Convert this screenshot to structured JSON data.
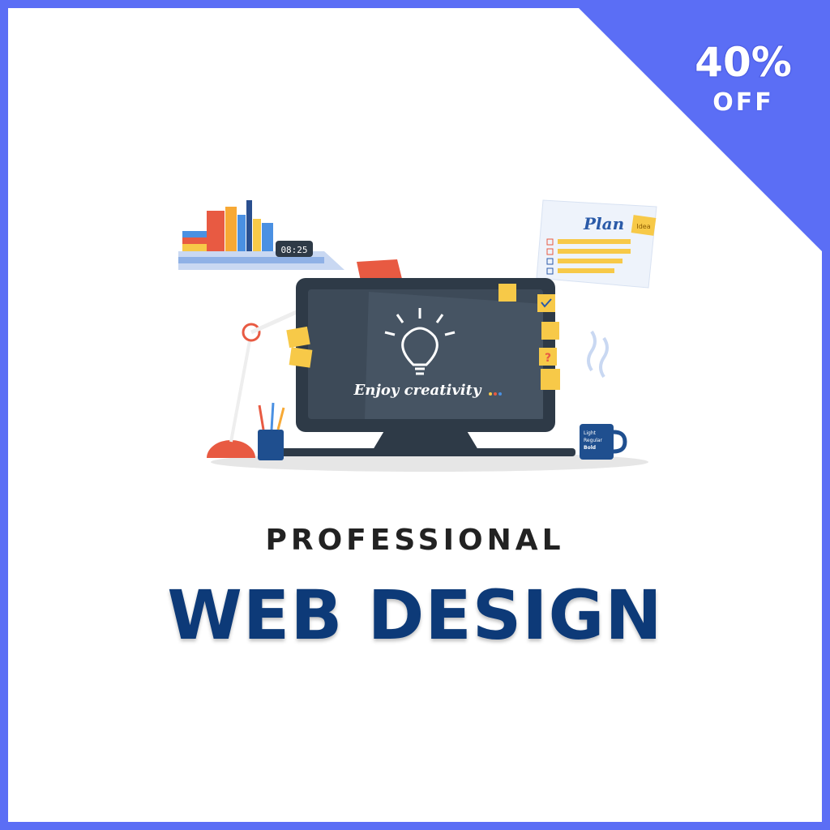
{
  "badge": {
    "percent": "40%",
    "off": "OFF",
    "color": "#5b6ef5"
  },
  "illustration": {
    "screen_text": "Enjoy creativity",
    "clock_time": "08:25",
    "plan_title": "Plan",
    "note_label": "Idea",
    "mug_lines": [
      "Light",
      "Regular",
      "Bold"
    ]
  },
  "headline": {
    "top": "PROFESSIONAL",
    "main": "WEB DESIGN"
  },
  "colors": {
    "border": "#5b6ef5",
    "title": "#0d3a78",
    "monitor": "#2e3a47",
    "lamp": "#e85a42",
    "note": "#f7c948"
  }
}
